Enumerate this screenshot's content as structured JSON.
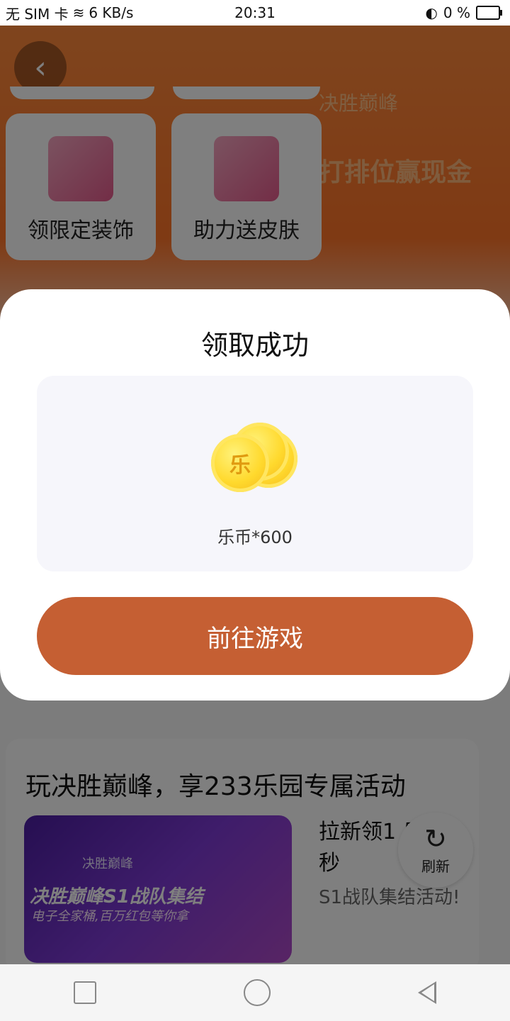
{
  "status_bar": {
    "left": "无 SIM 卡",
    "net_speed": "6 KB/s",
    "time": "20:31",
    "battery_pct": "0 %"
  },
  "page": {
    "brand": "决胜巅峰",
    "slogan": "打排位赢现金",
    "tabs": [
      {
        "label": "领限定装饰",
        "icon": "girl-avatar-icon"
      },
      {
        "label": "助力送皮肤",
        "icon": "girl-avatar-icon"
      }
    ],
    "section": {
      "title": "玩决胜巅峰，享233乐园专属活动",
      "promo_brand": "决胜巅峰",
      "promo_line1": "决胜巅峰S1战队集结",
      "promo_line2": "电子全家桶,百万红包等你拿",
      "promo_text": "拉新领1 乐币！秒",
      "promo_sub": "S1战队集结活动!"
    },
    "refresh_label": "刷新"
  },
  "modal": {
    "title": "领取成功",
    "coin_glyph": "乐",
    "reward_text": "乐币*600",
    "button_label": "前往游戏"
  },
  "colors": {
    "accent": "#c55f33",
    "banner": "#ff7a2e"
  }
}
